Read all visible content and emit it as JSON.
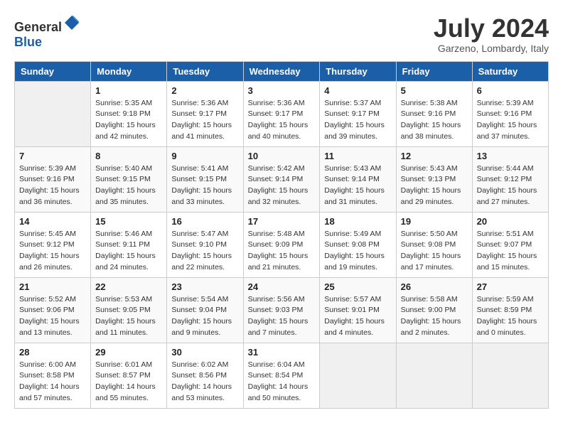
{
  "header": {
    "logo_general": "General",
    "logo_blue": "Blue",
    "month_title": "July 2024",
    "location": "Garzeno, Lombardy, Italy"
  },
  "columns": [
    "Sunday",
    "Monday",
    "Tuesday",
    "Wednesday",
    "Thursday",
    "Friday",
    "Saturday"
  ],
  "weeks": [
    [
      {
        "day": "",
        "info": ""
      },
      {
        "day": "1",
        "info": "Sunrise: 5:35 AM\nSunset: 9:18 PM\nDaylight: 15 hours\nand 42 minutes."
      },
      {
        "day": "2",
        "info": "Sunrise: 5:36 AM\nSunset: 9:17 PM\nDaylight: 15 hours\nand 41 minutes."
      },
      {
        "day": "3",
        "info": "Sunrise: 5:36 AM\nSunset: 9:17 PM\nDaylight: 15 hours\nand 40 minutes."
      },
      {
        "day": "4",
        "info": "Sunrise: 5:37 AM\nSunset: 9:17 PM\nDaylight: 15 hours\nand 39 minutes."
      },
      {
        "day": "5",
        "info": "Sunrise: 5:38 AM\nSunset: 9:16 PM\nDaylight: 15 hours\nand 38 minutes."
      },
      {
        "day": "6",
        "info": "Sunrise: 5:39 AM\nSunset: 9:16 PM\nDaylight: 15 hours\nand 37 minutes."
      }
    ],
    [
      {
        "day": "7",
        "info": "Sunrise: 5:39 AM\nSunset: 9:16 PM\nDaylight: 15 hours\nand 36 minutes."
      },
      {
        "day": "8",
        "info": "Sunrise: 5:40 AM\nSunset: 9:15 PM\nDaylight: 15 hours\nand 35 minutes."
      },
      {
        "day": "9",
        "info": "Sunrise: 5:41 AM\nSunset: 9:15 PM\nDaylight: 15 hours\nand 33 minutes."
      },
      {
        "day": "10",
        "info": "Sunrise: 5:42 AM\nSunset: 9:14 PM\nDaylight: 15 hours\nand 32 minutes."
      },
      {
        "day": "11",
        "info": "Sunrise: 5:43 AM\nSunset: 9:14 PM\nDaylight: 15 hours\nand 31 minutes."
      },
      {
        "day": "12",
        "info": "Sunrise: 5:43 AM\nSunset: 9:13 PM\nDaylight: 15 hours\nand 29 minutes."
      },
      {
        "day": "13",
        "info": "Sunrise: 5:44 AM\nSunset: 9:12 PM\nDaylight: 15 hours\nand 27 minutes."
      }
    ],
    [
      {
        "day": "14",
        "info": "Sunrise: 5:45 AM\nSunset: 9:12 PM\nDaylight: 15 hours\nand 26 minutes."
      },
      {
        "day": "15",
        "info": "Sunrise: 5:46 AM\nSunset: 9:11 PM\nDaylight: 15 hours\nand 24 minutes."
      },
      {
        "day": "16",
        "info": "Sunrise: 5:47 AM\nSunset: 9:10 PM\nDaylight: 15 hours\nand 22 minutes."
      },
      {
        "day": "17",
        "info": "Sunrise: 5:48 AM\nSunset: 9:09 PM\nDaylight: 15 hours\nand 21 minutes."
      },
      {
        "day": "18",
        "info": "Sunrise: 5:49 AM\nSunset: 9:08 PM\nDaylight: 15 hours\nand 19 minutes."
      },
      {
        "day": "19",
        "info": "Sunrise: 5:50 AM\nSunset: 9:08 PM\nDaylight: 15 hours\nand 17 minutes."
      },
      {
        "day": "20",
        "info": "Sunrise: 5:51 AM\nSunset: 9:07 PM\nDaylight: 15 hours\nand 15 minutes."
      }
    ],
    [
      {
        "day": "21",
        "info": "Sunrise: 5:52 AM\nSunset: 9:06 PM\nDaylight: 15 hours\nand 13 minutes."
      },
      {
        "day": "22",
        "info": "Sunrise: 5:53 AM\nSunset: 9:05 PM\nDaylight: 15 hours\nand 11 minutes."
      },
      {
        "day": "23",
        "info": "Sunrise: 5:54 AM\nSunset: 9:04 PM\nDaylight: 15 hours\nand 9 minutes."
      },
      {
        "day": "24",
        "info": "Sunrise: 5:56 AM\nSunset: 9:03 PM\nDaylight: 15 hours\nand 7 minutes."
      },
      {
        "day": "25",
        "info": "Sunrise: 5:57 AM\nSunset: 9:01 PM\nDaylight: 15 hours\nand 4 minutes."
      },
      {
        "day": "26",
        "info": "Sunrise: 5:58 AM\nSunset: 9:00 PM\nDaylight: 15 hours\nand 2 minutes."
      },
      {
        "day": "27",
        "info": "Sunrise: 5:59 AM\nSunset: 8:59 PM\nDaylight: 15 hours\nand 0 minutes."
      }
    ],
    [
      {
        "day": "28",
        "info": "Sunrise: 6:00 AM\nSunset: 8:58 PM\nDaylight: 14 hours\nand 57 minutes."
      },
      {
        "day": "29",
        "info": "Sunrise: 6:01 AM\nSunset: 8:57 PM\nDaylight: 14 hours\nand 55 minutes."
      },
      {
        "day": "30",
        "info": "Sunrise: 6:02 AM\nSunset: 8:56 PM\nDaylight: 14 hours\nand 53 minutes."
      },
      {
        "day": "31",
        "info": "Sunrise: 6:04 AM\nSunset: 8:54 PM\nDaylight: 14 hours\nand 50 minutes."
      },
      {
        "day": "",
        "info": ""
      },
      {
        "day": "",
        "info": ""
      },
      {
        "day": "",
        "info": ""
      }
    ]
  ]
}
